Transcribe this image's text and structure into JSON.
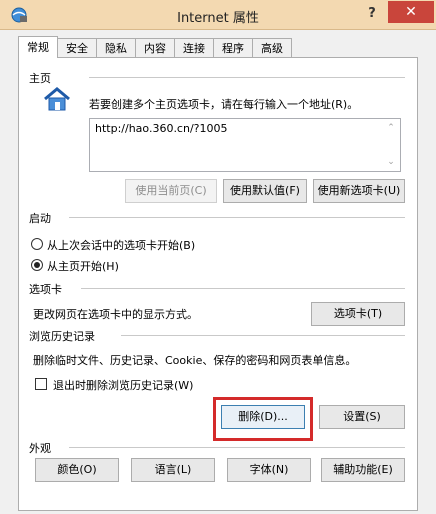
{
  "window": {
    "title": "Internet 属性",
    "help": "?",
    "close": "✕"
  },
  "tabs": [
    {
      "label": "常规",
      "active": true
    },
    {
      "label": "安全"
    },
    {
      "label": "隐私"
    },
    {
      "label": "内容"
    },
    {
      "label": "连接"
    },
    {
      "label": "程序"
    },
    {
      "label": "高级"
    }
  ],
  "home": {
    "group_label": "主页",
    "instruction": "若要创建多个主页选项卡，请在每行输入一个地址(R)。",
    "url": "http://hao.360.cn/?1005",
    "btn_current": "使用当前页(C)",
    "btn_default": "使用默认值(F)",
    "btn_newtab": "使用新选项卡(U)"
  },
  "startup": {
    "group_label": "启动",
    "option_last": "从上次会话中的选项卡开始(B)",
    "option_home": "从主页开始(H)",
    "selected": "home"
  },
  "tabs_section": {
    "group_label": "选项卡",
    "description": "更改网页在选项卡中的显示方式。",
    "button": "选项卡(T)"
  },
  "history": {
    "group_label": "浏览历史记录",
    "description": "删除临时文件、历史记录、Cookie、保存的密码和网页表单信息。",
    "checkbox_label": "退出时删除浏览历史记录(W)",
    "checked": false,
    "btn_delete": "删除(D)...",
    "btn_settings": "设置(S)"
  },
  "appearance": {
    "group_label": "外观",
    "btn_colors": "颜色(O)",
    "btn_languages": "语言(L)",
    "btn_fonts": "字体(N)",
    "btn_accessibility": "辅助功能(E)"
  },
  "colors": {
    "titlebar": "#f3d9b1",
    "close": "#c9453b",
    "highlight_box": "#d42a2a"
  }
}
